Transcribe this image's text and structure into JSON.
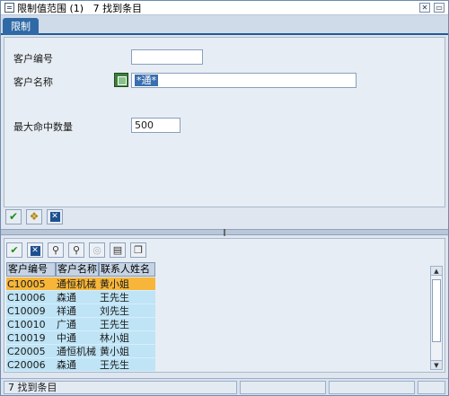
{
  "window": {
    "title": "限制值范围 (1)   7 找到条目",
    "close_glyph": "✕",
    "resize_glyph": "▭"
  },
  "tabs": [
    {
      "label": "限制"
    }
  ],
  "form": {
    "customer_no": {
      "label": "客户编号",
      "value": ""
    },
    "customer_name": {
      "label": "客户名称",
      "value": "*通*"
    },
    "max_hits": {
      "label": "最大命中数量",
      "value": "500"
    }
  },
  "form_buttons": [
    "check-icon",
    "binoculars-icon",
    "cancel-icon"
  ],
  "results": {
    "toolbar": [
      "check-icon",
      "cancel-icon",
      "find-icon",
      "find-next-icon",
      "filter-icon",
      "print-icon",
      "copy-icon"
    ],
    "columns": [
      "客户编号",
      "客户名称",
      "联系人姓名"
    ],
    "rows": [
      [
        "C10005",
        "通恒机械",
        "黄小姐"
      ],
      [
        "C10006",
        "森通",
        "王先生"
      ],
      [
        "C10009",
        "祥通",
        "刘先生"
      ],
      [
        "C10010",
        "广通",
        "王先生"
      ],
      [
        "C10019",
        "中通",
        "林小姐"
      ],
      [
        "C20005",
        "通恒机械",
        "黄小姐"
      ],
      [
        "C20006",
        "森通",
        "王先生"
      ]
    ],
    "selected_row": 0
  },
  "status": {
    "message": "7 找到条目"
  },
  "colors": {
    "accent": "#2f6aa6",
    "selected_row": "#f7b63a",
    "row_bg": "#bfe4f6"
  }
}
